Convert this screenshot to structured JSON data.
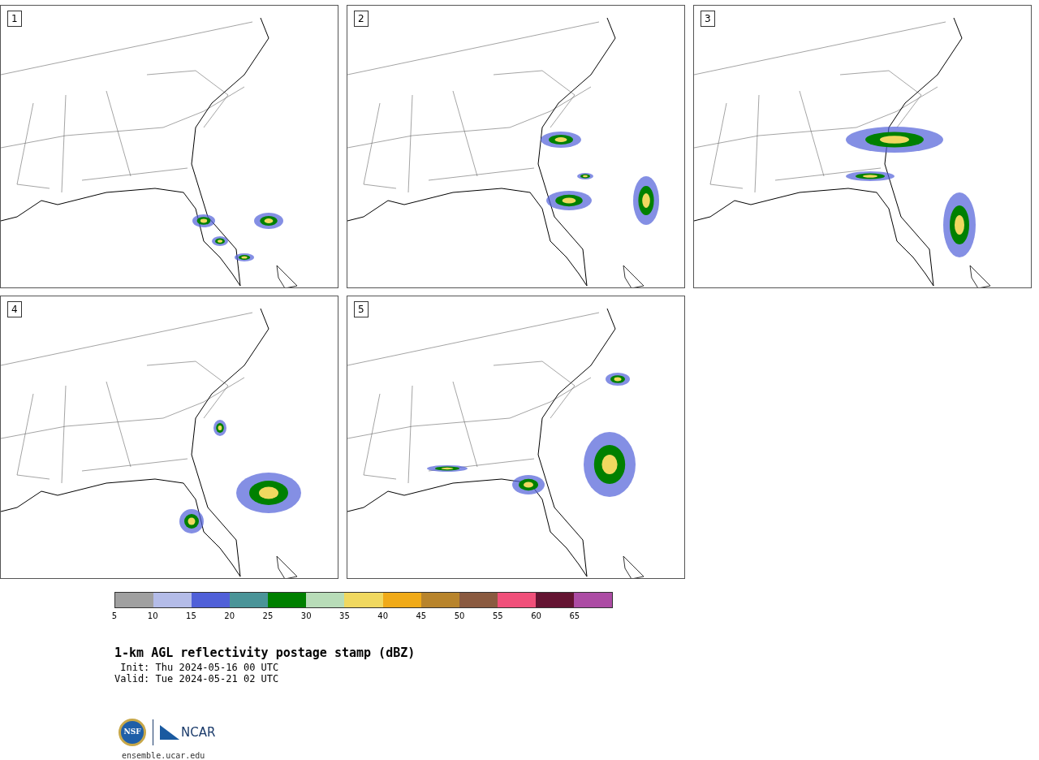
{
  "panels": [
    {
      "label": "1"
    },
    {
      "label": "2"
    },
    {
      "label": "3"
    },
    {
      "label": "4"
    },
    {
      "label": "5"
    }
  ],
  "colorbar": {
    "bins": [
      {
        "color": "#a0a0a0"
      },
      {
        "color": "#b4bce8"
      },
      {
        "color": "#5060d8"
      },
      {
        "color": "#4a9498"
      },
      {
        "color": "#008000"
      },
      {
        "color": "#b8dcb8"
      },
      {
        "color": "#f0d860"
      },
      {
        "color": "#f0aa18"
      },
      {
        "color": "#b8842c"
      },
      {
        "color": "#8a5a40"
      },
      {
        "color": "#f0507a"
      },
      {
        "color": "#641432"
      },
      {
        "color": "#ac4ca4"
      }
    ],
    "ticks": [
      "5",
      "10",
      "15",
      "20",
      "25",
      "30",
      "35",
      "40",
      "45",
      "50",
      "55",
      "60",
      "65"
    ]
  },
  "title": "1-km AGL reflectivity postage stamp (dBZ)",
  "init": " Init: Thu 2024-05-16 00 UTC",
  "valid": "Valid: Tue 2024-05-21 02 UTC",
  "logo": {
    "left": "NSF",
    "right": "NCAR"
  },
  "url": "ensemble.ucar.edu"
}
